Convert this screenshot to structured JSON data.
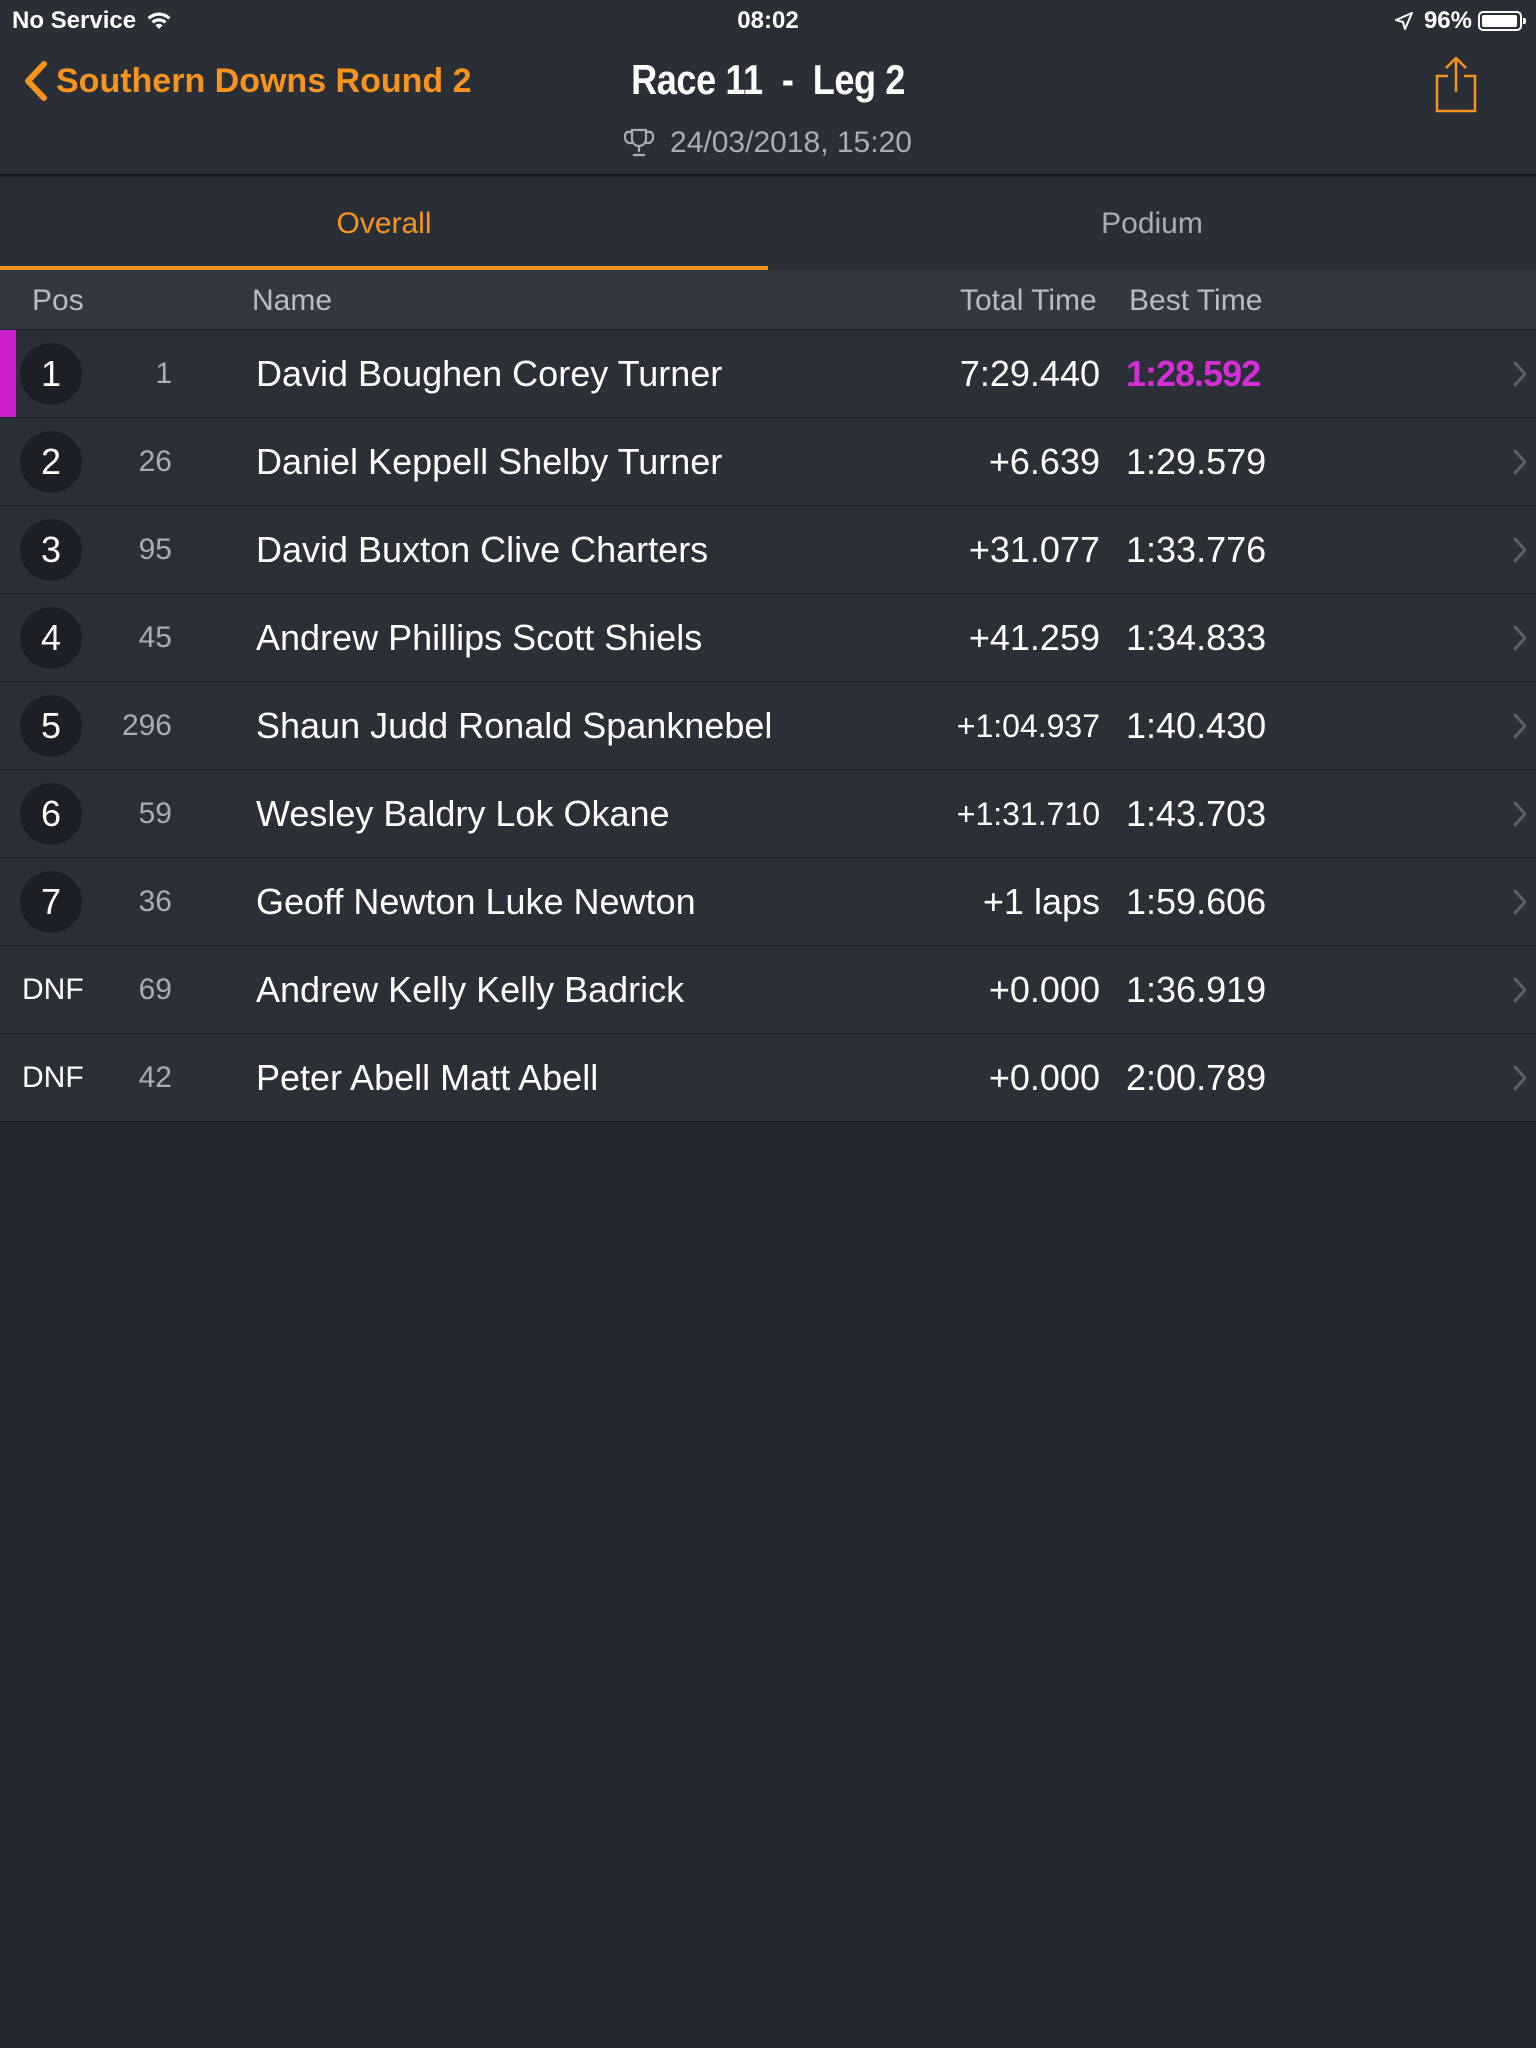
{
  "status_bar": {
    "carrier": "No Service",
    "time": "08:02",
    "battery": "96%",
    "battery_level": 0.96
  },
  "nav": {
    "back_label": "Southern Downs Round 2",
    "title": "Race 11  -  Leg 2",
    "subtitle": "24/03/2018, 15:20"
  },
  "tabs": [
    {
      "label": "Overall",
      "active": true
    },
    {
      "label": "Podium",
      "active": false
    }
  ],
  "columns": {
    "pos": "Pos",
    "name": "Name",
    "total_time": "Total Time",
    "best_time": "Best Time"
  },
  "colors": {
    "accent": "#f7941d",
    "fastest": "#d62ed6",
    "background": "#21252d",
    "row": "#2b2f37"
  },
  "results": [
    {
      "pos": "1",
      "num": "1",
      "name": "David Boughen Corey Turner",
      "total": "7:29.440",
      "best": "1:28.592",
      "fastest": true,
      "circle": true
    },
    {
      "pos": "2",
      "num": "26",
      "name": "Daniel Keppell Shelby Turner",
      "total": "+6.639",
      "best": "1:29.579",
      "fastest": false,
      "circle": true
    },
    {
      "pos": "3",
      "num": "95",
      "name": "David Buxton Clive Charters",
      "total": "+31.077",
      "best": "1:33.776",
      "fastest": false,
      "circle": true
    },
    {
      "pos": "4",
      "num": "45",
      "name": "Andrew Phillips Scott Shiels",
      "total": "+41.259",
      "best": "1:34.833",
      "fastest": false,
      "circle": true
    },
    {
      "pos": "5",
      "num": "296",
      "name": "Shaun Judd Ronald Spanknebel",
      "total": "+1:04.937",
      "best": "1:40.430",
      "fastest": false,
      "circle": true
    },
    {
      "pos": "6",
      "num": "59",
      "name": "Wesley Baldry Lok Okane",
      "total": "+1:31.710",
      "best": "1:43.703",
      "fastest": false,
      "circle": true
    },
    {
      "pos": "7",
      "num": "36",
      "name": "Geoff Newton Luke Newton",
      "total": "+1 laps",
      "best": "1:59.606",
      "fastest": false,
      "circle": true
    },
    {
      "pos": "DNF",
      "num": "69",
      "name": "Andrew Kelly Kelly Badrick",
      "total": "+0.000",
      "best": "1:36.919",
      "fastest": false,
      "circle": false
    },
    {
      "pos": "DNF",
      "num": "42",
      "name": "Peter Abell Matt Abell",
      "total": "+0.000",
      "best": "2:00.789",
      "fastest": false,
      "circle": false
    }
  ]
}
